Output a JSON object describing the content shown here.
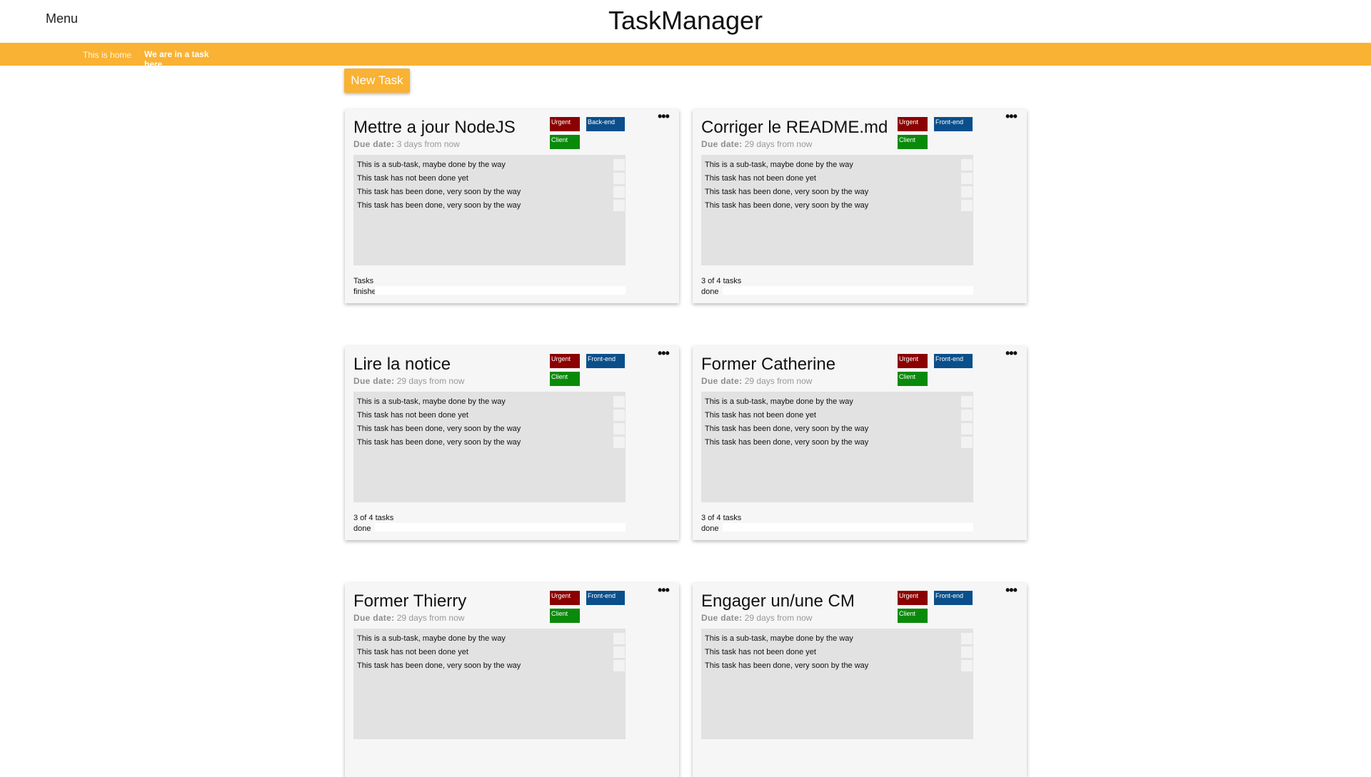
{
  "header": {
    "menu_label": "Menu",
    "title": "TaskManager"
  },
  "breadcrumb": {
    "home": "This is home",
    "current": "We are in a task here"
  },
  "actions": {
    "new_task": "New Task"
  },
  "colors": {
    "accent": "#f9b233",
    "urgent": "#8b0000",
    "area": "#0a4f8b",
    "client": "#0a8a0a"
  },
  "cards": [
    {
      "title": "Mettre a jour NodeJS",
      "due_label": "Due date:",
      "due_value": "3 days from now",
      "tags": {
        "urgent": "Urgent",
        "area": "Back-end",
        "client": "Client"
      },
      "menu_icon": "•••",
      "subtasks": [
        "This is a sub-task, maybe done by the way",
        "This task has not been done yet",
        "This task has been done, very soon by the way",
        "This task has been done, very soon by the way"
      ],
      "progress_line1": "Tasks",
      "progress_line2": "finished!",
      "progress_fraction": 1.0
    },
    {
      "title": "Corriger le README.md",
      "due_label": "Due date:",
      "due_value": "29 days from now",
      "tags": {
        "urgent": "Urgent",
        "area": "Front-end",
        "client": "Client"
      },
      "menu_icon": "•••",
      "subtasks": [
        "This is a sub-task, maybe done by the way",
        "This task has not been done yet",
        "This task has been done, very soon by the way",
        "This task has been done, very soon by the way"
      ],
      "progress_line1": "3 of 4 tasks",
      "progress_line2": "done",
      "progress_fraction": 0.75
    },
    {
      "title": "Lire la notice",
      "due_label": "Due date:",
      "due_value": "29 days from now",
      "tags": {
        "urgent": "Urgent",
        "area": "Front-end",
        "client": "Client"
      },
      "menu_icon": "•••",
      "subtasks": [
        "This is a sub-task, maybe done by the way",
        "This task has not been done yet",
        "This task has been done, very soon by the way",
        "This task has been done, very soon by the way"
      ],
      "progress_line1": "3 of 4 tasks",
      "progress_line2": "done",
      "progress_fraction": 0.75
    },
    {
      "title": "Former Catherine",
      "due_label": "Due date:",
      "due_value": "29 days from now",
      "tags": {
        "urgent": "Urgent",
        "area": "Front-end",
        "client": "Client"
      },
      "menu_icon": "•••",
      "subtasks": [
        "This is a sub-task, maybe done by the way",
        "This task has not been done yet",
        "This task has been done, very soon by the way",
        "This task has been done, very soon by the way"
      ],
      "progress_line1": "3 of 4 tasks",
      "progress_line2": "done",
      "progress_fraction": 0.75
    },
    {
      "title": "Former Thierry",
      "due_label": "Due date:",
      "due_value": "29 days from now",
      "tags": {
        "urgent": "Urgent",
        "area": "Front-end",
        "client": "Client"
      },
      "menu_icon": "•••",
      "subtasks": [
        "This is a sub-task, maybe done by the way",
        "This task has not been done yet",
        "This task has been done, very soon by the way"
      ],
      "progress_line1": "",
      "progress_line2": ""
    },
    {
      "title": "Engager un/une CM",
      "due_label": "Due date:",
      "due_value": "29 days from now",
      "tags": {
        "urgent": "Urgent",
        "area": "Front-end",
        "client": "Client"
      },
      "menu_icon": "•••",
      "subtasks": [
        "This is a sub-task, maybe done by the way",
        "This task has not been done yet",
        "This task has been done, very soon by the way"
      ],
      "progress_line1": "",
      "progress_line2": ""
    }
  ]
}
